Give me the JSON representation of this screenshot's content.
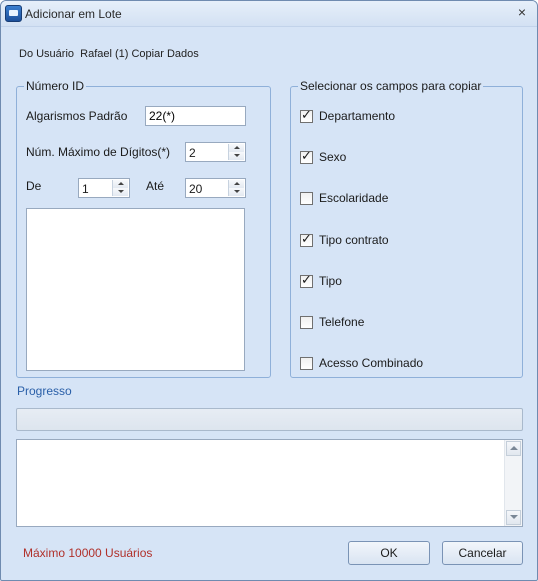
{
  "window": {
    "title": "Adicionar em Lote",
    "close_glyph": "×",
    "accent_color": "#2a5fa8",
    "icons": {
      "app": "app-icon",
      "close": "close-icon"
    }
  },
  "from_user": "Do Usuário  Rafael (1) Copiar Dados",
  "id_group": {
    "legend": "Número ID",
    "default_digits_label": "Algarismos Padrão",
    "default_digits_value": "22(*)",
    "max_digits_label": "Núm. Máximo de Dígitos(*)",
    "max_digits_value": "2",
    "from_label": "De",
    "from_value": "1",
    "to_label": "Até",
    "to_value": "20",
    "id_list": []
  },
  "fields_group": {
    "legend": "Selecionar os campos para copiar",
    "fields": [
      {
        "label": "Departamento",
        "checked": true
      },
      {
        "label": "Sexo",
        "checked": true
      },
      {
        "label": "Escolaridade",
        "checked": false
      },
      {
        "label": "Tipo contrato",
        "checked": true
      },
      {
        "label": "Tipo",
        "checked": true
      },
      {
        "label": "Telefone",
        "checked": false
      },
      {
        "label": "Acesso Combinado",
        "checked": false
      }
    ]
  },
  "progress": {
    "label": "Progresso",
    "fraction": 0
  },
  "log": {
    "lines": []
  },
  "footer": {
    "max_users": "Máximo 10000 Usuários",
    "max_users_color": "#b0302a",
    "ok_label": "OK",
    "cancel_label": "Cancelar"
  }
}
